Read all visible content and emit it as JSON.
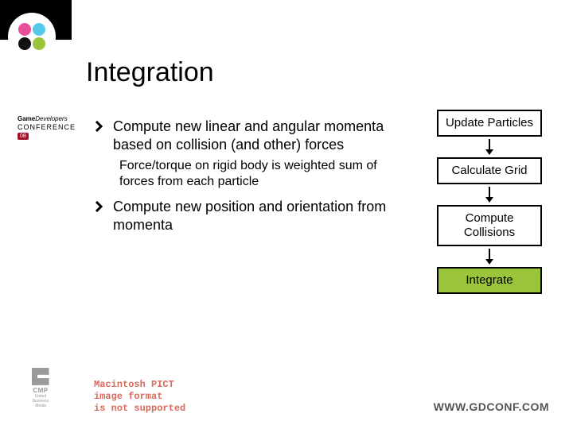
{
  "title": "Integration",
  "sidebar_badge": {
    "line1a": "Game",
    "line1b": "Developers",
    "line2": "CONFERENCE",
    "year": "08"
  },
  "bullets": {
    "b1": "Compute new linear and angular momenta based on collision (and other) forces",
    "b1_sub": "Force/torque on rigid body is weighted sum of forces from each particle",
    "b2": "Compute new position and orientation from momenta"
  },
  "flow": {
    "box1": "Update Particles",
    "box2": "Calculate Grid",
    "box3": "Compute Collisions",
    "box4": "Integrate"
  },
  "pict_error": {
    "l1": "Macintosh PICT",
    "l2": "image format",
    "l3": "is not supported"
  },
  "footer": {
    "cmp": "CMP",
    "cmp_sub": "United Business Media",
    "url": "WWW.GDCONF.COM"
  }
}
